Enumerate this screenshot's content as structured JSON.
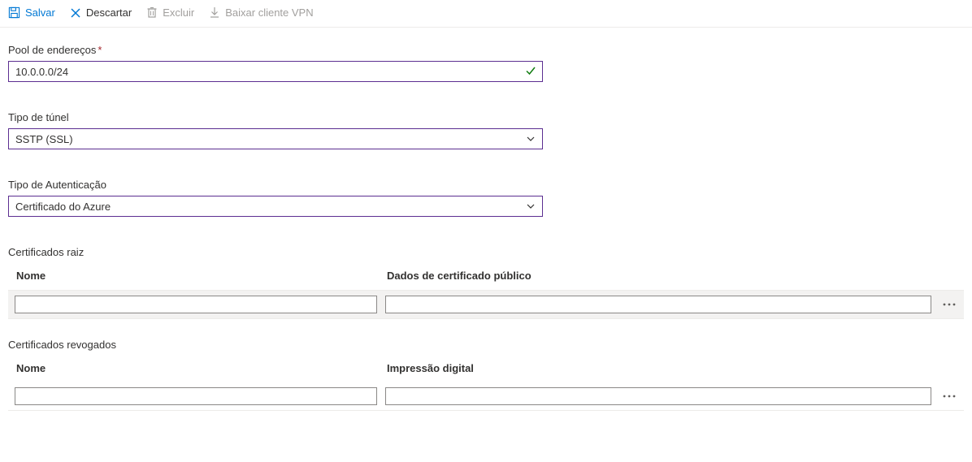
{
  "toolbar": {
    "save_label": "Salvar",
    "discard_label": "Descartar",
    "delete_label": "Excluir",
    "download_label": "Baixar cliente VPN"
  },
  "fields": {
    "address_pool": {
      "label": "Pool de endereços",
      "value": "10.0.0.0/24",
      "required": true
    },
    "tunnel_type": {
      "label": "Tipo de túnel",
      "value": "SSTP (SSL)"
    },
    "auth_type": {
      "label": "Tipo de Autenticação",
      "value": "Certificado do Azure"
    }
  },
  "root_certs": {
    "heading": "Certificados raiz",
    "col_name": "Nome",
    "col_data": "Dados de certificado público"
  },
  "revoked_certs": {
    "heading": "Certificados revogados",
    "col_name": "Nome",
    "col_thumb": "Impressão digital"
  }
}
